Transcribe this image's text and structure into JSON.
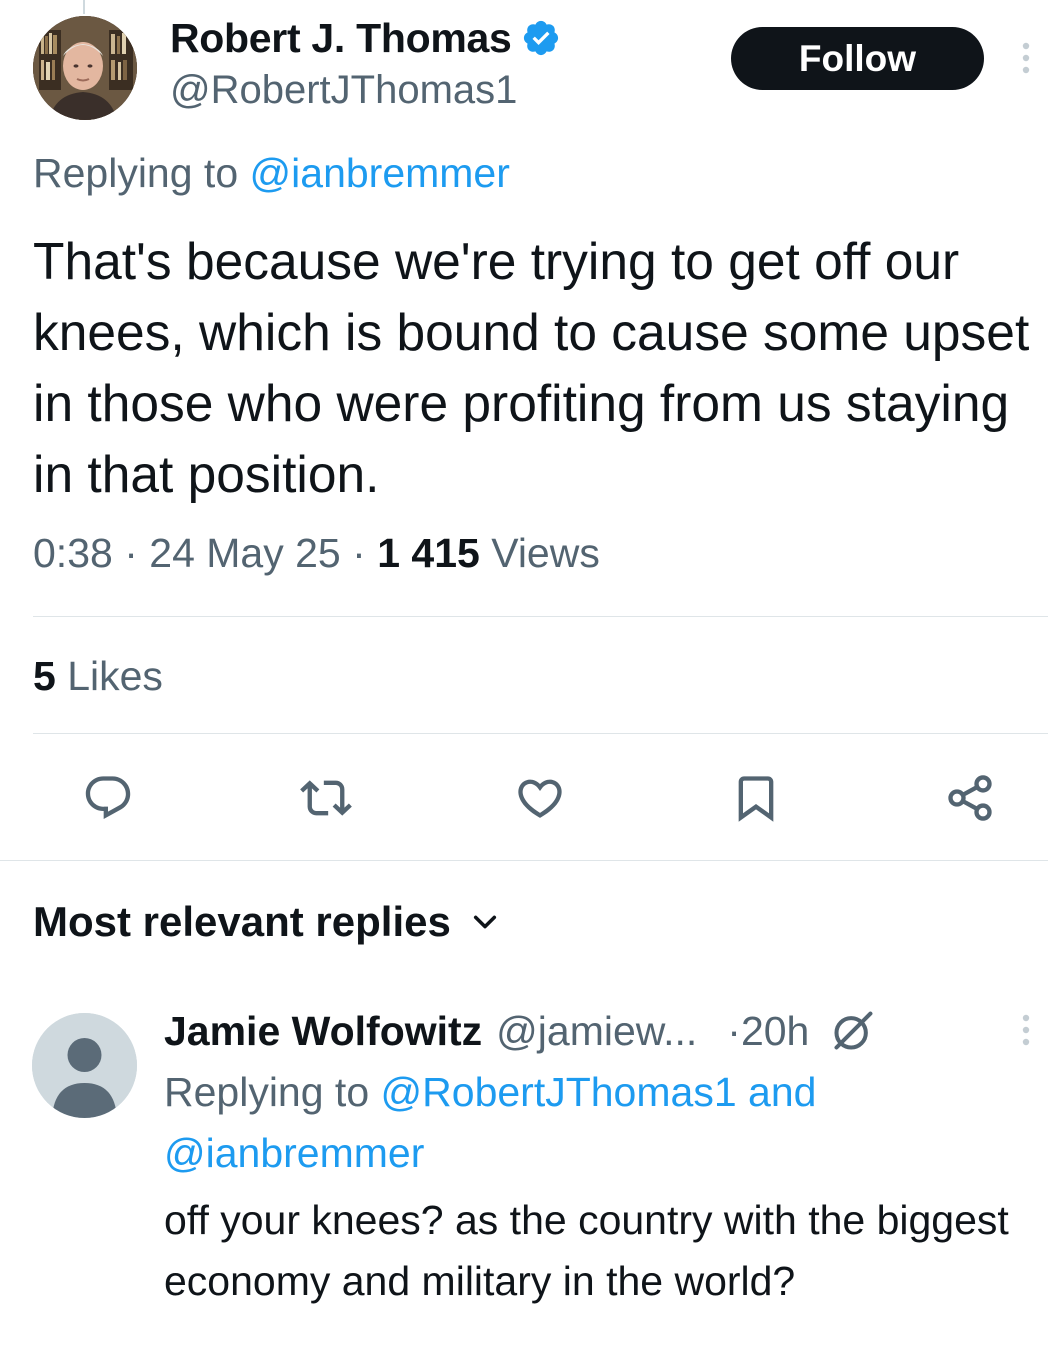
{
  "tweet": {
    "author": {
      "name": "Robert J. Thomas",
      "handle": "@RobertJThomas1",
      "verified": true
    },
    "follow_label": "Follow",
    "replying_prefix": "Replying to",
    "replying_to": "@ianbremmer",
    "text": "That's because we're trying to get off our knees, which is bound to cause some upset in those who were profiting from us staying in that position.",
    "time": "0:38",
    "date": "24 May 25",
    "views_count": "1 415",
    "views_label": "Views",
    "likes_count": "5",
    "likes_label": "Likes",
    "actions": [
      {
        "name": "reply-icon"
      },
      {
        "name": "retweet-icon"
      },
      {
        "name": "like-icon"
      },
      {
        "name": "bookmark-icon"
      },
      {
        "name": "share-icon"
      }
    ]
  },
  "replies_section": {
    "sort_label": "Most relevant replies",
    "sort_icon": "chevron-down-icon"
  },
  "reply": {
    "name": "Jamie Wolfowitz",
    "handle": "@jamiew...",
    "time": "·20h",
    "replying_prefix": "Replying to",
    "replying_to_1": "@RobertJThomas1",
    "replying_and": "and",
    "replying_to_2": "@ianbremmer",
    "text": "off your knees? as the country with the biggest economy and military in the world?"
  },
  "colors": {
    "accent": "#1d9bf0",
    "text_primary": "#0f1419",
    "text_secondary": "#536471",
    "follow_bg": "#0f1419",
    "divider": "#dfe5e8"
  }
}
